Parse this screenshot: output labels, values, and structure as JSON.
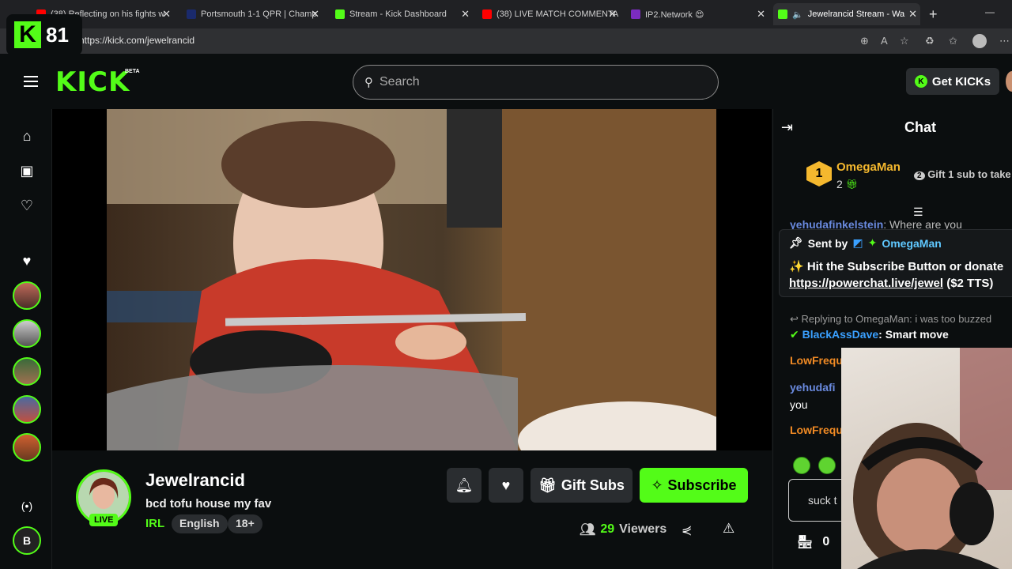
{
  "browser": {
    "tabs": [
      {
        "label": "(38) Reflecting on his fights w",
        "color": "#ff0000"
      },
      {
        "label": "Portsmouth 1-1 QPR | Champ",
        "color": "#1a2a6c"
      },
      {
        "label": "Stream - Kick Dashboard",
        "color": "#53fc18"
      },
      {
        "label": "(38) LIVE MATCH COMMENTA",
        "color": "#ff0000"
      },
      {
        "label": "IP2.Network 😍",
        "color": "#7b2cbf"
      },
      {
        "label": "Jewelrancid Stream - Wa",
        "color": "#53fc18"
      }
    ],
    "url": "https://kick.com/jewelrancid",
    "new_tab": "+",
    "minimize": "—"
  },
  "overlay": {
    "kick_count": "81"
  },
  "nav": {
    "logo": "KICK",
    "logo_beta": "BETA",
    "search_placeholder": "Search",
    "get_kicks": "Get KICKs"
  },
  "stream": {
    "channel": "Jewelrancid",
    "title": "bcd tofu house my fav",
    "category": "IRL",
    "tags": [
      "English",
      "18+"
    ],
    "live_badge": "LIVE",
    "gift_subs": "Gift Subs",
    "subscribe": "Subscribe",
    "viewers_count": "29",
    "viewers_label": "Viewers"
  },
  "chat": {
    "title": "Chat",
    "pinned_user": "OmegaMan",
    "pinned_count": "2",
    "pinned_rank": "1",
    "gift_prompt": "Gift 1 sub to take",
    "gift_rank": "2",
    "partial_line_user": "yehudafinkelstein",
    "partial_line_text": ": Where are you",
    "pinned_message": {
      "sent_by_label": "Sent by",
      "sender": "OmegaMan",
      "text": "✨ Hit the Subscribe Button or donate",
      "link": "https://powerchat.live/jewel",
      "link_suffix": " ($2 TTS)"
    },
    "reply_to": "Replying to OmegaMan: i was too buzzed",
    "messages": [
      {
        "user": "BlackAssDave",
        "text": ": Smart move",
        "color": "#3aa0ff"
      },
      {
        "user": "LowFrequ",
        "text": "",
        "color": "#f08a24"
      },
      {
        "user": "yehudafi",
        "text": "",
        "color": "#f08a24"
      },
      {
        "user": "",
        "text": "you",
        "color": "#ffffff"
      },
      {
        "user": "LowFrequ",
        "text": "",
        "color": "#f08a24"
      }
    ],
    "input_value": "suck t",
    "store_count": "0"
  }
}
